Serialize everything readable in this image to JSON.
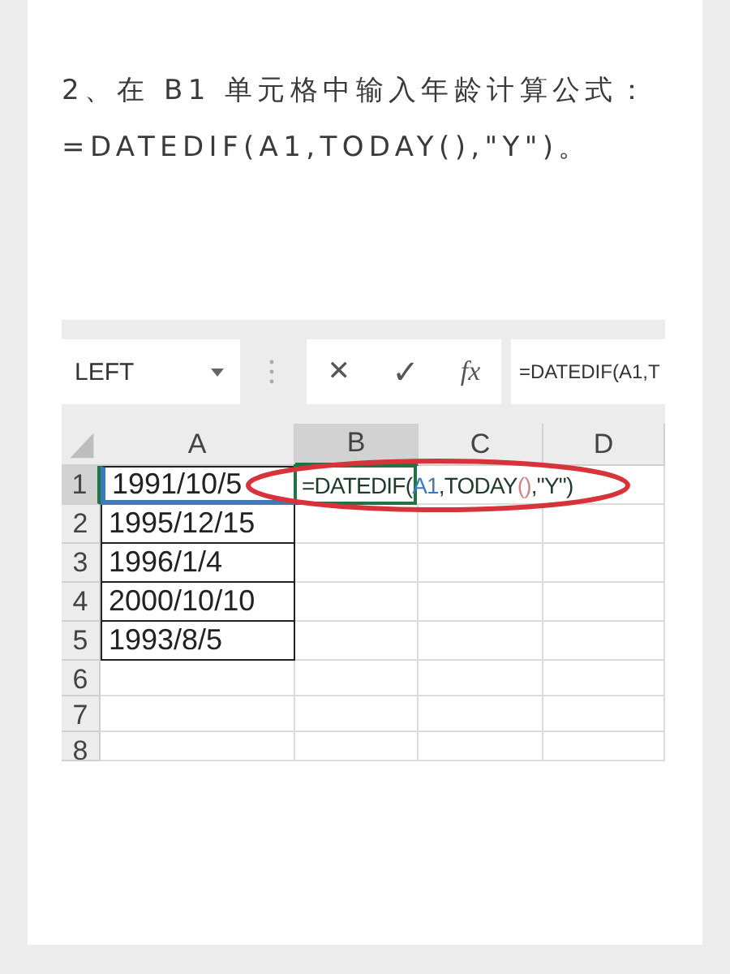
{
  "instruction_lines": [
    "2、在 B1 单元格中输入年龄计算公式：",
    "=DATEDIF(A1,TODAY(),\"Y\")。"
  ],
  "spreadsheet": {
    "name_box": "LEFT",
    "cancel_symbol": "✕",
    "enter_symbol": "✓",
    "function_symbol": "fx",
    "formula_bar": "=DATEDIF(A1,T",
    "columns": [
      {
        "label": "A",
        "selected": false
      },
      {
        "label": "B",
        "selected": true
      },
      {
        "label": "C",
        "selected": false
      },
      {
        "label": "D",
        "selected": false
      }
    ],
    "rows": [
      {
        "label": "1",
        "selected": true,
        "value": "1991/10/5",
        "referenced": true,
        "formula_parts": [
          {
            "text": "=DATEDIF(",
            "color": "#1f3b2a"
          },
          {
            "text": "A1",
            "color": "#3d7ab8"
          },
          {
            "text": ",TODAY",
            "color": "#1f3b2a"
          },
          {
            "text": "()",
            "color": "#c98a86"
          },
          {
            "text": ",\"Y\")",
            "color": "#1f3b2a"
          }
        ]
      },
      {
        "label": "2",
        "selected": false,
        "value": "1995/12/15",
        "referenced": false
      },
      {
        "label": "3",
        "selected": false,
        "value": "1996/1/4",
        "referenced": false
      },
      {
        "label": "4",
        "selected": false,
        "value": "2000/10/10",
        "referenced": false
      },
      {
        "label": "5",
        "selected": false,
        "value": "1993/8/5",
        "referenced": false
      },
      {
        "label": "6",
        "selected": false
      },
      {
        "label": "7",
        "selected": false
      },
      {
        "label": "8",
        "selected": false
      }
    ],
    "annotation": {
      "kind": "ellipse",
      "color": "#d8323a"
    }
  }
}
